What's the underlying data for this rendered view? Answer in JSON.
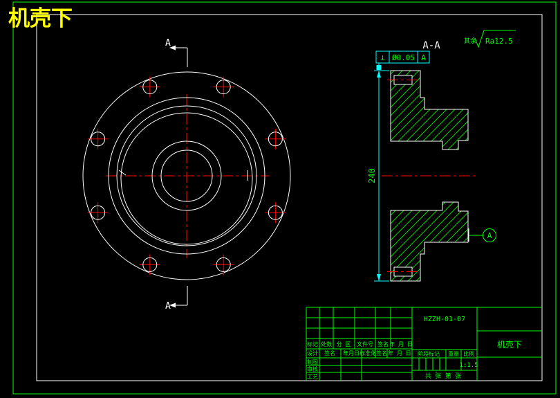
{
  "drawing_title": "机壳下",
  "colors": {
    "background": "#000000",
    "border_green": "#00ff00",
    "line_white": "#ffffff",
    "centerline_red": "#ff0000",
    "dimension_cyan": "#00ffff",
    "title_yellow": "#ffff00"
  },
  "annotations": {
    "section_label": "A-A",
    "section_arrow_letter": "A",
    "surface_note": "其余",
    "surface_roughness": "Ra12.5",
    "dim_height": "240",
    "fcf_symbol": "⊥",
    "fcf_tolerance": "Ø0.05",
    "fcf_datum": "A",
    "datum_label": "A"
  },
  "title_block": {
    "drawing_number": "HZZH-01-07",
    "part_name": "机壳下",
    "scale_value": "1:1.5",
    "header_row": [
      "标记",
      "处数",
      "分 区",
      "文件号",
      "签名",
      "年 月 日"
    ],
    "sign_row": [
      "设计",
      "签名",
      "年月日",
      "标准化",
      "签名",
      "年 月 日"
    ],
    "left_labels": [
      "制图",
      "审核",
      "工艺"
    ],
    "stage_headers": [
      "阶段标记",
      "重量",
      "比例"
    ],
    "sheet_note": "共  张  第  张"
  }
}
